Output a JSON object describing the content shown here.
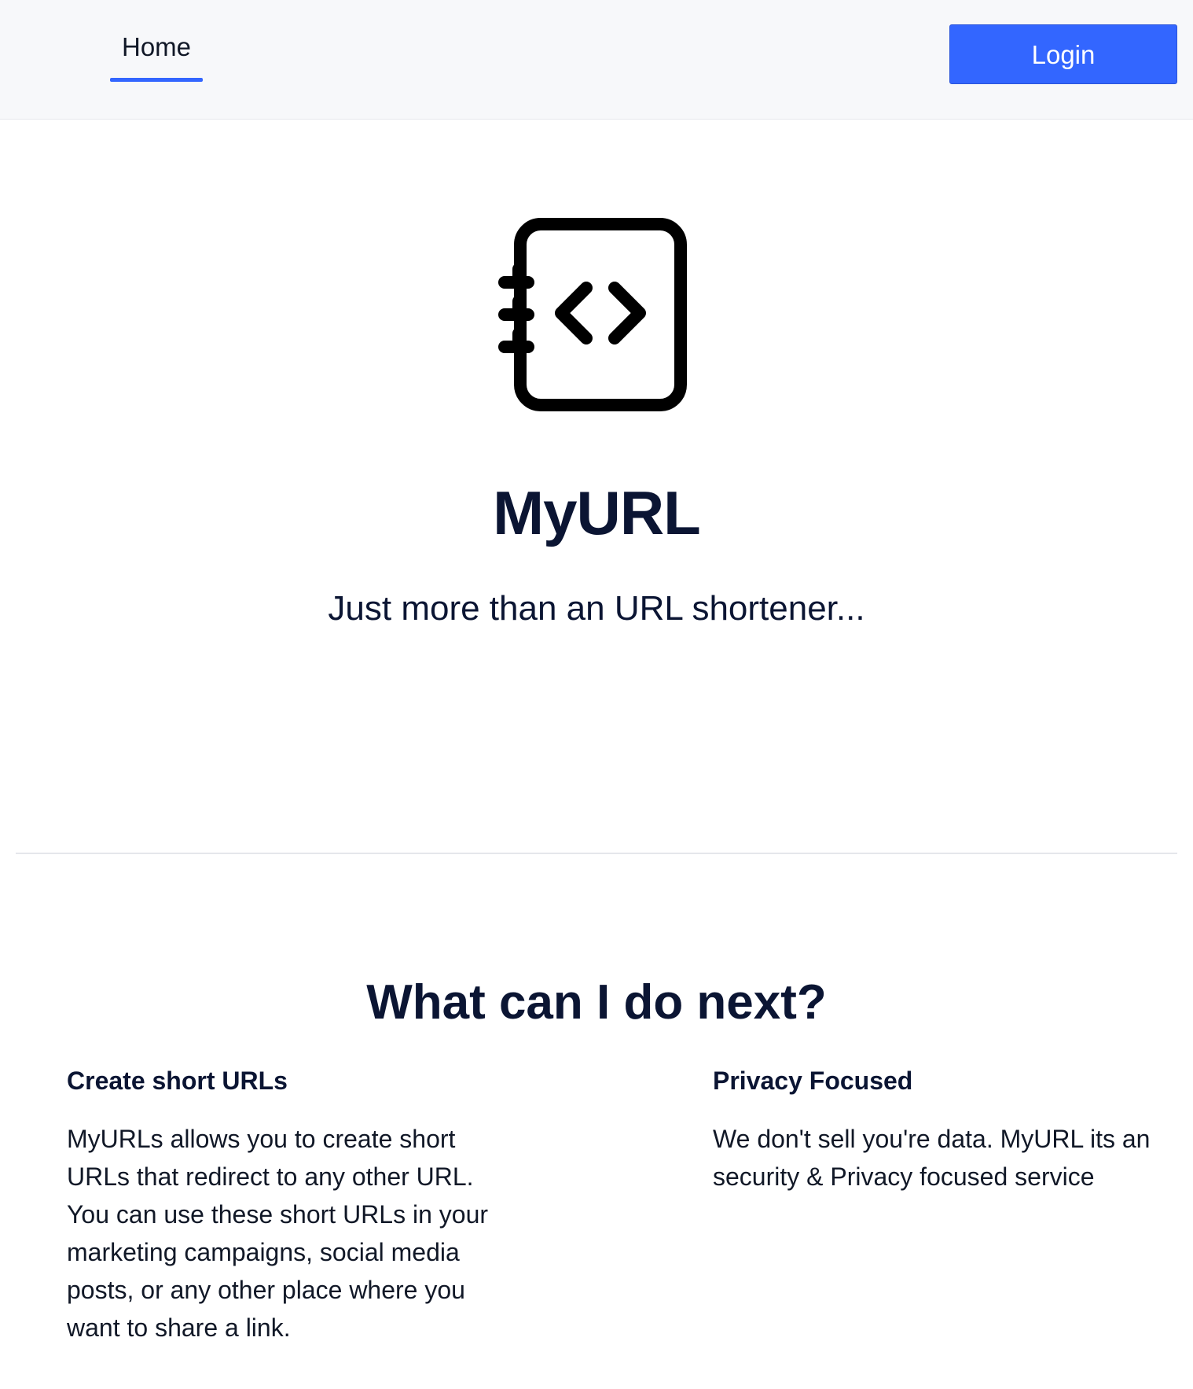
{
  "nav": {
    "home_label": "Home",
    "login_label": "Login",
    "accent_color": "#3366ff"
  },
  "hero": {
    "logo_icon": "notebook-code-icon",
    "title": "MyURL",
    "subtitle": "Just more than an URL shortener..."
  },
  "section": {
    "title": "What can I do next?"
  },
  "features": [
    {
      "title": "Create short URLs",
      "text": "MyURLs allows you to create short URLs that redirect to any other URL. You can use these short URLs in your marketing campaigns, social media posts, or any other place where you want to share a link."
    },
    {
      "title": "Privacy Focused",
      "text": "We don't sell you're data. MyURL its an security & Privacy focused service"
    }
  ]
}
